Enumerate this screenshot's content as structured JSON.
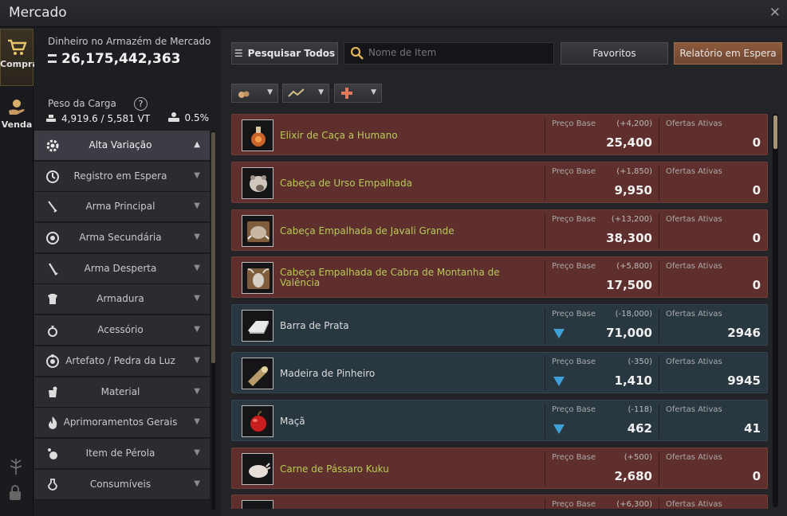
{
  "window": {
    "title": "Mercado",
    "close": "✕"
  },
  "tabs": [
    {
      "label": "Compra",
      "icon": "cart-icon",
      "active": true
    },
    {
      "label": "Venda",
      "icon": "hand-money-icon",
      "active": false
    }
  ],
  "wallet": {
    "label": "Dinheiro no Armazém de Mercado",
    "value": "26,175,442,363"
  },
  "weight": {
    "label": "Peso da Carga",
    "help": "?",
    "value": "4,919.6 / 5,581 VT",
    "tax": "0.5%"
  },
  "categories": [
    {
      "label": "Alta Variação",
      "icon": "gear-icon",
      "active": true,
      "arrow": "▲"
    },
    {
      "label": "Registro em Espera",
      "icon": "clock-icon",
      "arrow": "▼"
    },
    {
      "label": "Arma Principal",
      "icon": "sword-icon",
      "arrow": "▼"
    },
    {
      "label": "Arma Secundária",
      "icon": "orb-icon",
      "arrow": "▼"
    },
    {
      "label": "Arma Desperta",
      "icon": "blade-icon",
      "arrow": "▼"
    },
    {
      "label": "Armadura",
      "icon": "armor-icon",
      "arrow": "▼"
    },
    {
      "label": "Acessório",
      "icon": "ring-icon",
      "arrow": "▼"
    },
    {
      "label": "Artefato / Pedra da Luz",
      "icon": "artifact-icon",
      "arrow": "▼"
    },
    {
      "label": "Material",
      "icon": "material-icon",
      "arrow": "▼"
    },
    {
      "label": "Aprimoramentos Gerais",
      "icon": "flame-icon",
      "arrow": "▼"
    },
    {
      "label": "Item de Pérola",
      "icon": "pearl-icon",
      "arrow": "▼"
    },
    {
      "label": "Consumíveis",
      "icon": "potion-icon",
      "arrow": "▼"
    }
  ],
  "toolbar": {
    "search_all": "Pesquisar Todos",
    "search_placeholder": "Nome de Item",
    "favorites": "Favoritos",
    "report": "Relatório em Espera"
  },
  "filters": [
    {
      "icon": "bag-icon",
      "arrow": "▼"
    },
    {
      "icon": "trend-icon",
      "arrow": "▼"
    },
    {
      "icon": "plus-icon",
      "arrow": "▼"
    }
  ],
  "labels": {
    "base_price": "Preço Base",
    "offers": "Ofertas Ativas"
  },
  "items": [
    {
      "name": "Elixir de Caça a Humano",
      "change": "(+4,200)",
      "price": "25,400",
      "offers": "0",
      "style": "red",
      "icon": "elixir-icon",
      "trend": "up"
    },
    {
      "name": "Cabeça de Urso Empalhada",
      "change": "(+1,850)",
      "price": "9,950",
      "offers": "0",
      "style": "red",
      "icon": "bear-head-icon",
      "trend": "up"
    },
    {
      "name": "Cabeça Empalhada de Javali Grande",
      "change": "(+13,200)",
      "price": "38,300",
      "offers": "0",
      "style": "red",
      "icon": "boar-head-icon",
      "trend": "up"
    },
    {
      "name": "Cabeça Empalhada de Cabra de Montanha de Valência",
      "change": "(+5,800)",
      "price": "17,500",
      "offers": "0",
      "style": "red",
      "icon": "goat-head-icon",
      "trend": "up"
    },
    {
      "name": "Barra de Prata",
      "change": "(-18,000)",
      "price": "71,000",
      "offers": "2946",
      "style": "blue",
      "icon": "silver-bar-icon",
      "trend": "down"
    },
    {
      "name": "Madeira de Pinheiro",
      "change": "(-350)",
      "price": "1,410",
      "offers": "9945",
      "style": "blue",
      "icon": "log-icon",
      "trend": "down"
    },
    {
      "name": "Maçã",
      "change": "(-118)",
      "price": "462",
      "offers": "41",
      "style": "blue",
      "icon": "apple-icon",
      "trend": "down"
    },
    {
      "name": "Carne de Pássaro Kuku",
      "change": "(+500)",
      "price": "2,680",
      "offers": "0",
      "style": "red",
      "icon": "bird-meat-icon",
      "trend": "up"
    },
    {
      "name": "",
      "change": "(+6,300)",
      "price": "",
      "offers": "",
      "style": "red",
      "icon": "item-icon",
      "trend": "up"
    }
  ]
}
